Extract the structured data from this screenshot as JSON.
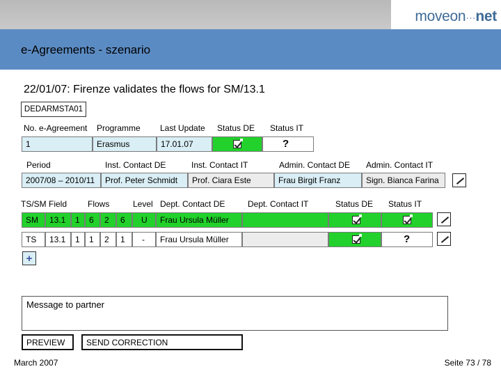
{
  "header": {
    "logo": {
      "part1": "moveon",
      "dots": "···",
      "part2": "net"
    },
    "title": "e-Agreements - szenario"
  },
  "subtitle": "22/01/07: Firenze validates the flows for SM/13.1",
  "agreement_code": "DEDARMSTA01",
  "agreement": {
    "headers": {
      "no": "No. e-Agreement",
      "programme": "Programme",
      "last_update": "Last Update",
      "status_de": "Status DE",
      "status_it": "Status IT"
    },
    "values": {
      "no": "1",
      "programme": "Erasmus",
      "last_update": "17.01.07",
      "status_de_icon": "checked-box-icon",
      "status_it": "?"
    }
  },
  "period": {
    "headers": {
      "period": "Period",
      "inst_de": "Inst. Contact DE",
      "inst_it": "Inst. Contact IT",
      "admin_de": "Admin. Contact DE",
      "admin_it": "Admin. Contact IT"
    },
    "values": {
      "period": "2007/08 – 2010/11",
      "inst_de": "Prof. Peter Schmidt",
      "inst_it": "Prof. Ciara Este",
      "admin_de": "Frau Birgit Franz",
      "admin_it": "Sign. Bianca Farina"
    }
  },
  "flows": {
    "headers": {
      "ts_sm": "TS/SM",
      "field": "Field",
      "flows": "Flows",
      "level": "Level",
      "dept_de": "Dept. Contact DE",
      "dept_it": "Dept. Contact IT",
      "status_de": "Status DE",
      "status_it": "Status IT"
    },
    "rows": [
      {
        "type": "SM",
        "field": "13.1",
        "f1": "1",
        "f2": "6",
        "f3": "2",
        "f4": "6",
        "level": "U",
        "dept_de": "Frau Ursula Müller",
        "dept_it": "",
        "status_de_icon": "checked-box-icon",
        "status_it_icon": "checked-box-icon",
        "status_it": ""
      },
      {
        "type": "TS",
        "field": "13.1",
        "f1": "1",
        "f2": "1",
        "f3": "2",
        "f4": "1",
        "level": "-",
        "dept_de": "Frau Ursula Müller",
        "dept_it": "",
        "status_de_icon": "checked-box-icon",
        "status_it": "?"
      }
    ],
    "add_label": "+"
  },
  "message": {
    "placeholder": "Message to partner"
  },
  "buttons": {
    "preview": "PREVIEW",
    "send_correction": "SEND CORRECTION"
  },
  "footer": {
    "date": "March 2007",
    "page": "Seite 73 / 78"
  },
  "colors": {
    "banner": "#5b8bc3",
    "green_row": "#22d12b",
    "light_blue": "#d9eef5",
    "logo_blue": "#3f6b97"
  }
}
